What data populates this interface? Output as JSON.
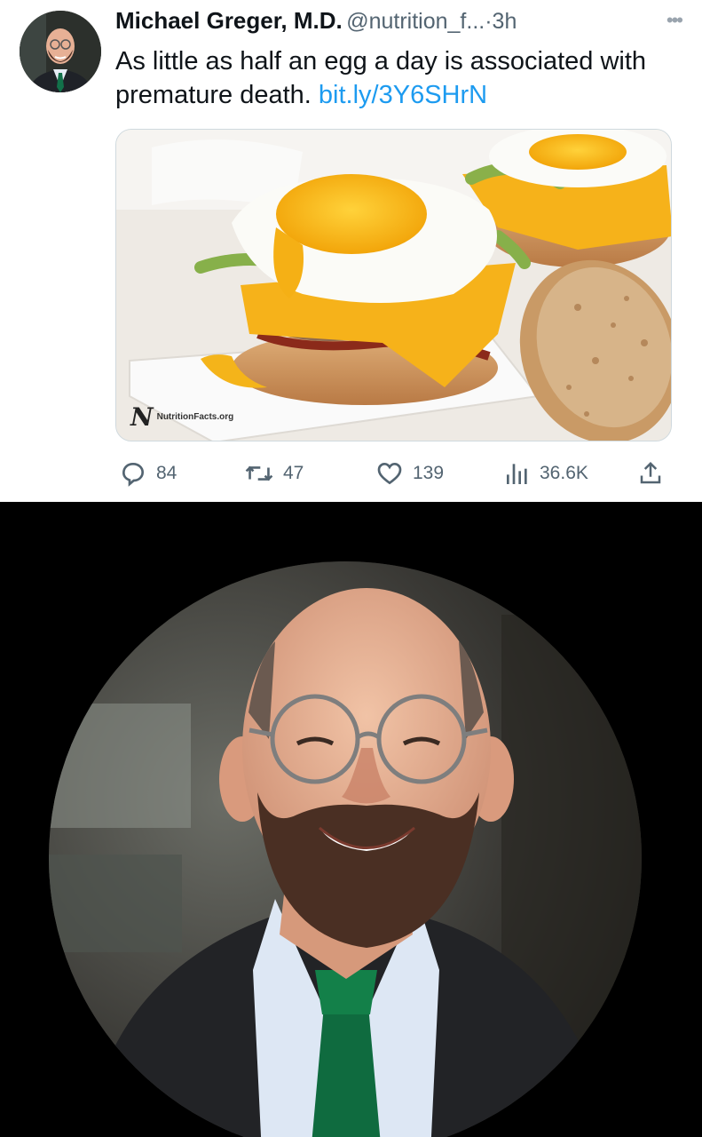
{
  "tweet": {
    "author_name": "Michael Greger, M.D.",
    "handle": "@nutrition_f...",
    "dot": "·",
    "time": "3h",
    "more_icon": "more-horizontal-icon",
    "text": "As little as half an egg a day is associated with premature death.",
    "link": "bit.ly/3Y6SHrN",
    "media": {
      "description_icon": "egg-sandwich-photo",
      "watermark_logo": "N",
      "watermark_text": "NutritionFacts.org"
    },
    "actions": {
      "replies": "84",
      "retweets": "47",
      "likes": "139",
      "views": "36.6K"
    }
  },
  "colors": {
    "accent": "#1d9bf0",
    "secondary_text": "#536471",
    "tie": "#0f6b3f"
  }
}
